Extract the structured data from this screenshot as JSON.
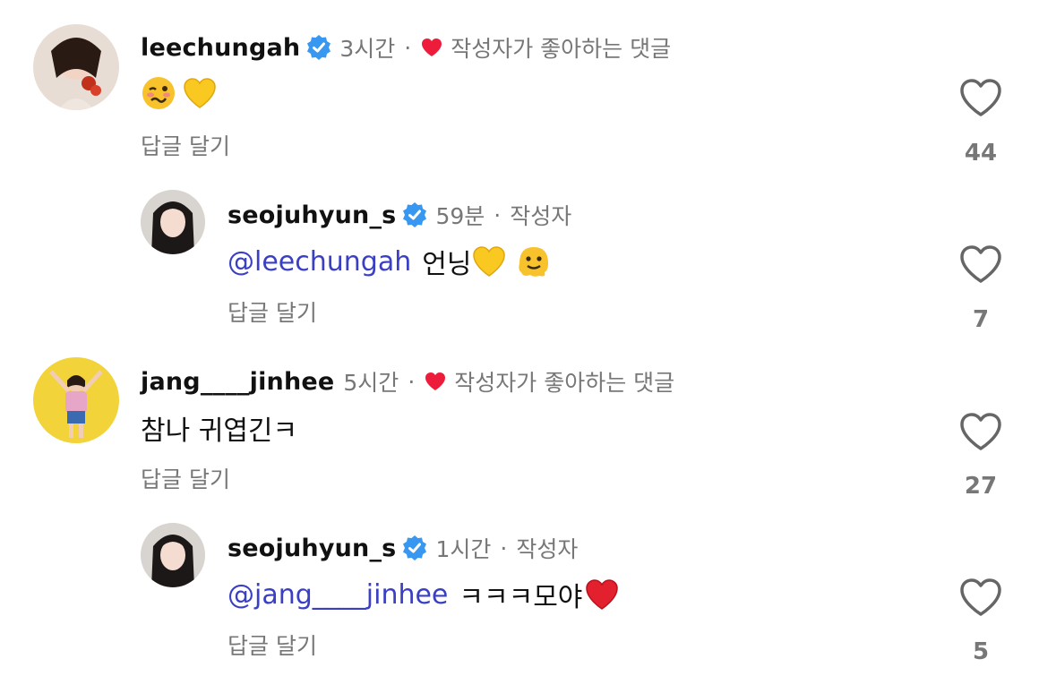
{
  "comments": [
    {
      "username": "leechungah",
      "time": "3시간",
      "sep": "·",
      "liked_by_author": "작성자가 좋아하는 댓글",
      "text": "",
      "emojis": [
        "woozy-face",
        "yellow-heart"
      ],
      "reply_label": "답글 달기",
      "likes": "44"
    },
    {
      "username": "seojuhyun_s",
      "time": "59분",
      "sep": "·",
      "author_label": "작성자",
      "mention": "@leechungah",
      "text": "언닝",
      "emojis": [
        "yellow-heart",
        "melting-face"
      ],
      "reply_label": "답글 달기",
      "likes": "7"
    },
    {
      "username": "jang____jinhee",
      "time": "5시간",
      "sep": "·",
      "liked_by_author": "작성자가 좋아하는 댓글",
      "text": "참나 귀엽긴ㅋ",
      "reply_label": "답글 달기",
      "likes": "27"
    },
    {
      "username": "seojuhyun_s",
      "time": "1시간",
      "sep": "·",
      "author_label": "작성자",
      "mention": "@jang____jinhee",
      "text": "ㅋㅋㅋ모야",
      "emojis": [
        "red-heart"
      ],
      "reply_label": "답글 달기",
      "likes": "5"
    }
  ],
  "colors": {
    "mention": "#3a3fc4",
    "meta": "#777777",
    "verified": "#3897f0",
    "heart": "#ed1c3a"
  }
}
